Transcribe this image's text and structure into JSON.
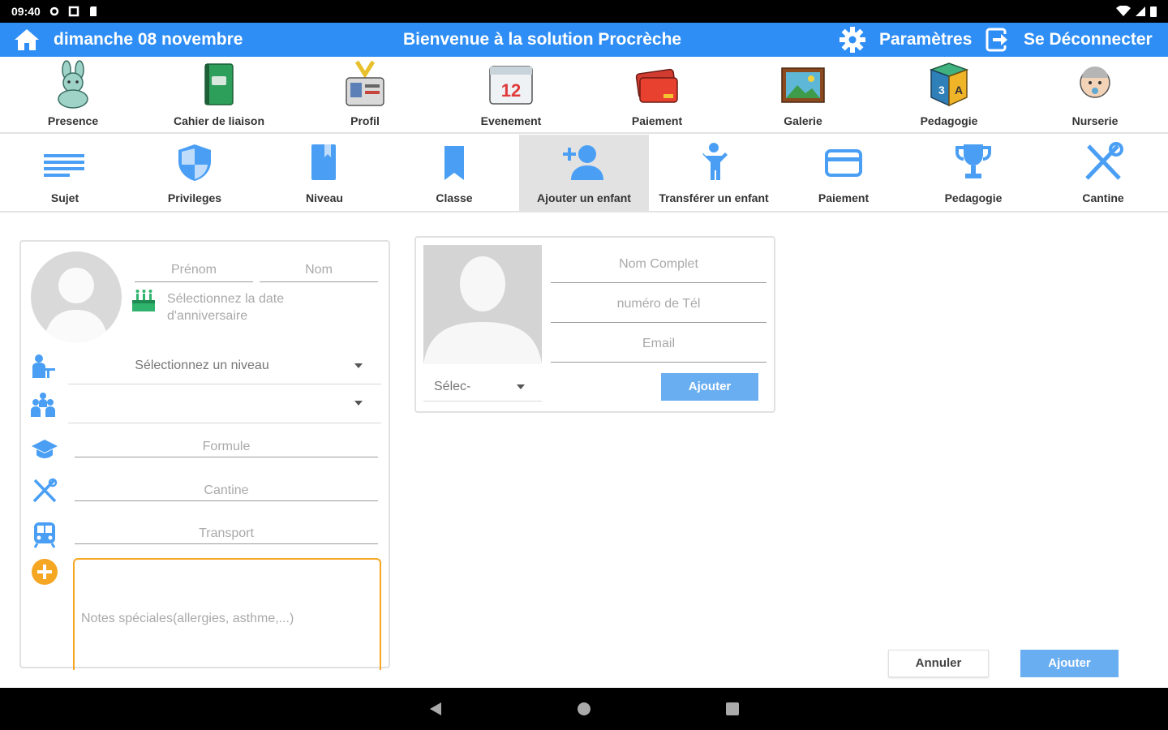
{
  "status_bar": {
    "time": "09:40"
  },
  "header": {
    "date": "dimanche 08 novembre",
    "welcome": "Bienvenue à la solution Procrèche",
    "settings_label": "Paramètres",
    "logout_label": "Se Déconnecter",
    "color": "#2f8ef5"
  },
  "modules": [
    {
      "label": "Presence",
      "icon": "rabbit-icon"
    },
    {
      "label": "Cahier de liaison",
      "icon": "notebook-icon"
    },
    {
      "label": "Profil",
      "icon": "id-badge-icon"
    },
    {
      "label": "Evenement",
      "icon": "calendar-icon"
    },
    {
      "label": "Paiement",
      "icon": "credit-card-icon"
    },
    {
      "label": "Galerie",
      "icon": "picture-icon"
    },
    {
      "label": "Pedagogie",
      "icon": "abc-blocks-icon"
    },
    {
      "label": "Nurserie",
      "icon": "baby-icon"
    }
  ],
  "tabs": [
    {
      "label": "Sujet",
      "icon": "subject-lines-icon"
    },
    {
      "label": "Privileges",
      "icon": "shield-icon"
    },
    {
      "label": "Niveau",
      "icon": "book-icon"
    },
    {
      "label": "Classe",
      "icon": "bookmark-icon"
    },
    {
      "label": "Ajouter un enfant",
      "icon": "add-person-icon",
      "active": true
    },
    {
      "label": "Transférer un enfant",
      "icon": "child-icon"
    },
    {
      "label": "Paiement",
      "icon": "card-icon"
    },
    {
      "label": "Pedagogie",
      "icon": "trophy-icon"
    },
    {
      "label": "Cantine",
      "icon": "fork-knife-icon"
    }
  ],
  "child_form": {
    "prenom_placeholder": "Prénom",
    "nom_placeholder": "Nom",
    "birthday_placeholder_line1": "Sélectionnez la date",
    "birthday_placeholder_line2": "d'anniversaire",
    "niveau_select": "Sélectionnez un niveau",
    "classe_select": "",
    "formule_placeholder": "Formule",
    "cantine_placeholder": "Cantine",
    "transport_placeholder": "Transport",
    "notes_placeholder": "Notes spéciales(allergies, asthme,...)"
  },
  "parent_form": {
    "nom_complet_placeholder": "Nom Complet",
    "tel_placeholder": "numéro de Tél",
    "email_placeholder": "Email",
    "relation_select": "Sélec-",
    "add_button": "Ajouter"
  },
  "actions": {
    "cancel": "Annuler",
    "submit": "Ajouter"
  },
  "colors": {
    "primary": "#2f8ef5",
    "button": "#6aaef2",
    "notes_border": "#f5a623",
    "add_icon": "#f5a623",
    "birthday_icon": "#2fb36d"
  }
}
